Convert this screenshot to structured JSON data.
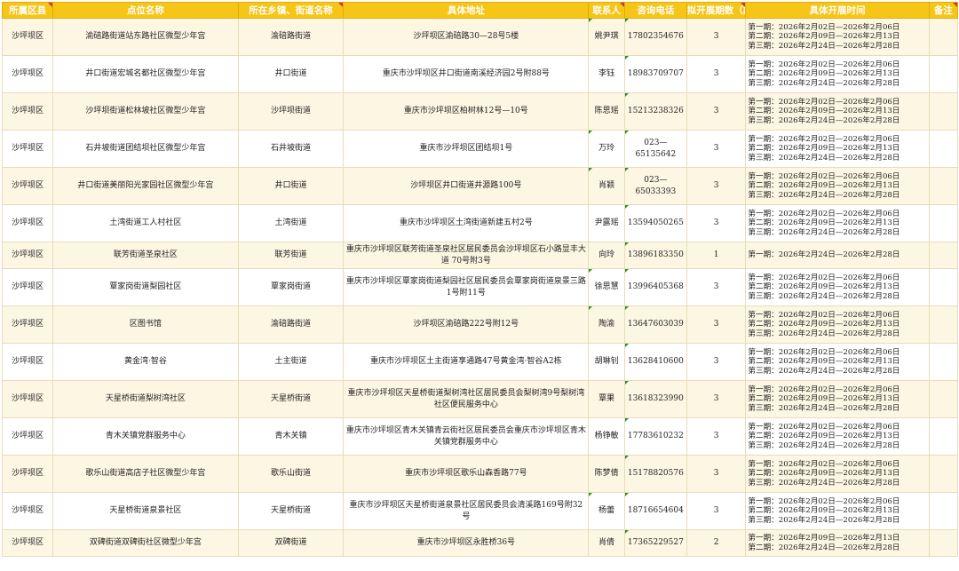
{
  "headers": [
    "所属区县",
    "点位名称",
    "所在乡镇、街道名称",
    "具体地址",
    "联系人",
    "咨询电话",
    "拟开展期数（期）",
    "具体开展时间",
    "备注"
  ],
  "rows": [
    {
      "district": "沙坪坝区",
      "name": "渝碚路街道站东路社区微型少年宫",
      "street": "渝碚路街道",
      "address": "沙坪坝区渝碚路30—28号5楼",
      "contact": "姚尹琪",
      "phone": "17802354676",
      "count": "3",
      "times": [
        "第一期：2026年2月02日—2026年2月06日",
        "第二期：2026年2月09日—2026年2月13日",
        "第三期：2026年2月24日—2026年2月28日"
      ]
    },
    {
      "district": "沙坪坝区",
      "name": "井口街道宏城名都社区微型少年宫",
      "street": "井口街道",
      "address": "重庆市沙坪坝区井口街道南溪经济园2号附88号",
      "contact": "李钰",
      "phone": "18983709707",
      "count": "3",
      "times": [
        "第一期：2026年2月02日—2026年2月06日",
        "第二期：2026年2月09日—2026年2月13日",
        "第三期：2026年2月24日—2026年2月28日"
      ]
    },
    {
      "district": "沙坪坝区",
      "name": "沙坪坝街道松林坡社区微型少年宫",
      "street": "沙坪坝街道",
      "address": "重庆市沙坪坝区柏树林12号—10号",
      "contact": "陈思瑶",
      "phone": "15213238326",
      "count": "3",
      "times": [
        "第一期：2026年2月02日—2026年2月06日",
        "第二期：2026年2月09日—2026年2月13日",
        "第三期：2026年2月24日—2026年2月28日"
      ]
    },
    {
      "district": "沙坪坝区",
      "name": "石井坡街道团结坝社区微型少年宫",
      "street": "石井坡街道",
      "address": "重庆市沙坪坝区团结坝1号",
      "contact": "万玲",
      "phone": "023—65135642",
      "count": "3",
      "times": [
        "第一期：2026年2月02日—2026年2月06日",
        "第二期：2026年2月09日—2026年2月13日",
        "第三期：2026年2月24日—2026年2月28日"
      ]
    },
    {
      "district": "沙坪坝区",
      "name": "井口街道美丽阳光家园社区微型少年宫",
      "street": "井口街道",
      "address": "沙坪坝区井口街道井源路100号",
      "contact": "肖颖",
      "phone": "023—65033393",
      "count": "3",
      "times": [
        "第一期：2026年2月02日—2026年2月06日",
        "第二期：2026年2月09日—2026年2月13日",
        "第三期：2026年2月24日—2026年2月28日"
      ]
    },
    {
      "district": "沙坪坝区",
      "name": "土湾街道工人村社区",
      "street": "土湾街道",
      "address": "重庆市沙坪坝区土湾街道新建五村2号",
      "contact": "尹露瑶",
      "phone": "13594050265",
      "count": "3",
      "times": [
        "第一期：2026年2月02日—2026年2月06日",
        "第二期：2026年2月09日—2026年2月13日",
        "第三期：2026年2月24日—2026年2月28日"
      ]
    },
    {
      "district": "沙坪坝区",
      "name": "联芳街道圣泉社区",
      "street": "联芳街道",
      "address": "重庆市沙坪坝区联芳街道圣泉社区居民委员会沙坪坝区石小路显丰大道 70号附3号",
      "contact": "向玲",
      "phone": "13896183350",
      "count": "1",
      "times": [
        "第一期：2026年2月24日—2026年2月28日"
      ]
    },
    {
      "district": "沙坪坝区",
      "name": "覃家岗街道梨园社区",
      "street": "覃家岗街道",
      "address": "重庆市沙坪坝区覃家岗街道梨园社区居民委员会覃家岗街道泉景三路1号附11号",
      "contact": "徐思慧",
      "phone": "13996405368",
      "count": "3",
      "times": [
        "第一期：2026年2月02日—2026年2月06日",
        "第二期：2026年2月09日—2026年2月13日",
        "第三期：2026年2月24日—2026年2月28日"
      ]
    },
    {
      "district": "沙坪坝区",
      "name": "区图书馆",
      "street": "渝碚路街道",
      "address": "沙坪坝区渝碚路222号附12号",
      "contact": "陶渝",
      "phone": "13647603039",
      "count": "3",
      "times": [
        "第一期：2026年2月02日—2026年2月06日",
        "第二期：2026年2月09日—2026年2月13日",
        "第三期：2026年2月24日—2026年2月28日"
      ]
    },
    {
      "district": "沙坪坝区",
      "name": "黄金湾·智谷",
      "street": "土主街道",
      "address": "重庆市沙坪坝区土主街道享通路47号黄金湾·智谷A2栋",
      "contact": "胡琳钊",
      "phone": "13628410600",
      "count": "3",
      "times": [
        "第一期：2026年2月02日—2026年2月06日",
        "第二期：2026年2月09日—2026年2月13日",
        "第三期：2026年2月24日—2026年2月28日"
      ]
    },
    {
      "district": "沙坪坝区",
      "name": "天星桥街道梨树湾社区",
      "street": "天星桥街道",
      "address": "重庆市沙坪坝区天星桥街道梨树湾社区居民委员会梨树湾9号梨树湾社区便民服务中心",
      "contact": "覃果",
      "phone": "13618323990",
      "count": "3",
      "times": [
        "第一期：2026年2月02日—2026年2月06日",
        "第二期：2026年2月09日—2026年2月13日",
        "第三期：2026年2月24日—2026年2月28日"
      ]
    },
    {
      "district": "沙坪坝区",
      "name": "青木关镇党群服务中心",
      "street": "青木关镇",
      "address": "重庆市沙坪坝区青木关镇青云街社区居民委员会重庆市沙坪坝区青木关镇党群服务中心",
      "contact": "杨铮敏",
      "phone": "17783610232",
      "count": "3",
      "times": [
        "第一期：2026年2月02日—2026年2月06日",
        "第二期：2026年2月09日—2026年2月13日",
        "第三期：2026年2月24日—2026年2月28日"
      ]
    },
    {
      "district": "沙坪坝区",
      "name": "歌乐山街道高店子社区微型少年宫",
      "street": "歌乐山街道",
      "address": "重庆市沙坪坝区歌乐山森香路77号",
      "contact": "陈梦倩",
      "phone": "15178820576",
      "count": "3",
      "times": [
        "第一期：2026年2月02日—2026年2月06日",
        "第二期：2026年2月09日—2026年2月13日",
        "第三期：2026年2月24日—2026年2月28日"
      ]
    },
    {
      "district": "沙坪坝区",
      "name": "天星桥街道泉景社区",
      "street": "天星桥街道",
      "address": "重庆市沙坪坝区天星桥街道泉景社区居民委员会清溪路169号附32号",
      "contact": "杨蕾",
      "phone": "18716654604",
      "count": "3",
      "times": [
        "第一期：2026年2月02日—2026年2月06日",
        "第二期：2026年2月09日—2026年2月13日",
        "第三期：2026年2月24日—2026年2月28日"
      ]
    },
    {
      "district": "沙坪坝区",
      "name": "双碑街道双碑街社区微型少年宫",
      "street": "双碑街道",
      "address": "重庆市沙坪坝区永胜桥36号",
      "contact": "肖倩",
      "phone": "17365229527",
      "count": "2",
      "times": [
        "第一期：2026年2月09日—2026年2月13日",
        "第二期：2026年2月24日—2026年2月28日"
      ]
    }
  ]
}
